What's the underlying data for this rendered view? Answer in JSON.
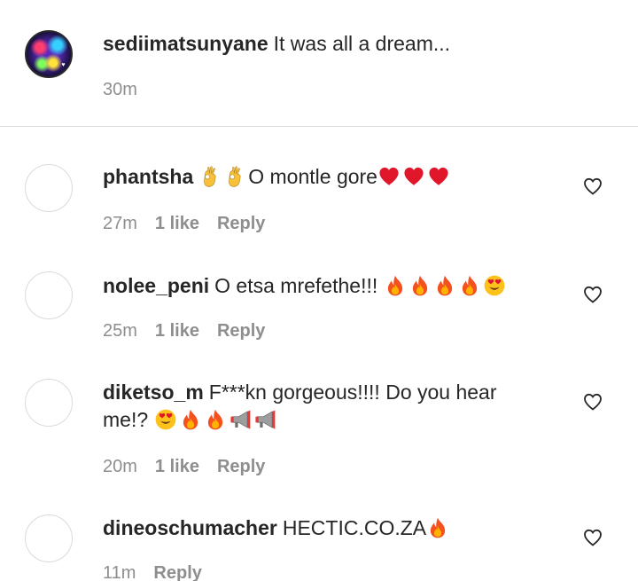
{
  "caption": {
    "username": "sediimatsunyane",
    "text": "It was all a dream...",
    "time": "30m"
  },
  "comments": [
    {
      "username": "phantsha",
      "text_after_emoji": "O montle gore",
      "time": "27m",
      "likes": "1 like",
      "reply": "Reply"
    },
    {
      "username": "nolee_peni",
      "text": "O etsa mrefethe!!!",
      "time": "25m",
      "likes": "1 like",
      "reply": "Reply"
    },
    {
      "username": "diketso_m",
      "text": "F***kn gorgeous!!!! Do you hear me!?",
      "time": "20m",
      "likes": "1 like",
      "reply": "Reply"
    },
    {
      "username": "dineoschumacher",
      "text": "HECTIC.CO.ZA",
      "time": "11m",
      "reply": "Reply"
    }
  ],
  "icons": {
    "like": "heart-outline-icon",
    "ok_hand": "ok-hand-emoji",
    "heart": "red-heart-emoji",
    "fire": "fire-emoji",
    "heart_eyes": "heart-eyes-emoji",
    "megaphone": "megaphone-emoji"
  },
  "colors": {
    "text": "#262626",
    "meta": "#8e8e8e",
    "divider": "#dbdbdb",
    "heart_emoji": "#e0162b"
  }
}
